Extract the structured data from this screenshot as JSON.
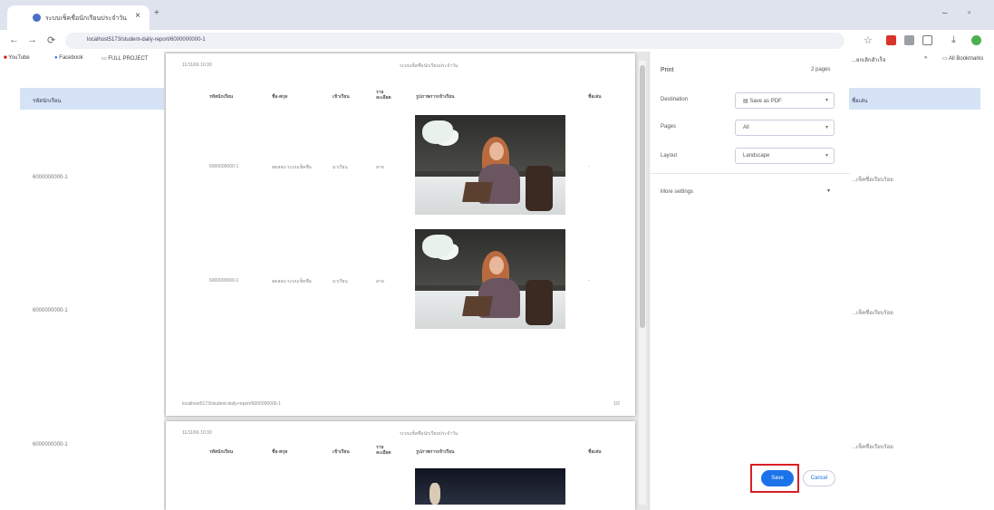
{
  "browser": {
    "tab_title": "ระบบเช็คชื่อนักเรียนประจำวัน",
    "url": "localhost5173/student-daily-report/6000000000-1",
    "bookmarks": [
      "YouTube",
      "Facebook",
      "FULL PROJECT"
    ],
    "bookmark_right": "All Bookmarks",
    "bookmark_partial": "...ยกเลิกสำเร็จ"
  },
  "background": {
    "header_left": "รหัสนักเรียน",
    "header_right": "ชื่อเล่น",
    "rows": [
      {
        "id": "6000000000-1",
        "right": "...เช็คชื่อเรียบร้อย"
      },
      {
        "id": "6000000000-1",
        "right": "...เช็คชื่อเรียบร้อย"
      },
      {
        "id": "6000000000-1",
        "right": "...เช็คชื่อเรียบร้อย"
      }
    ]
  },
  "preview": {
    "page1": {
      "header_left": "11/11/66 10:30",
      "header_center": "ระบบเช็คชื่อนักเรียนประจำวัน",
      "columns": [
        "รหัสนักเรียน",
        "ชื่อ-สกุล",
        "เข้าเรียน",
        "ราย ละเอียด",
        "รูปภาพการเข้าเรียน",
        "ชื่อเล่น"
      ],
      "rows": [
        [
          "6000000000-1",
          "ทดสอบ ระบบเช็คชื่อ",
          "มาเรียน",
          "สาย"
        ],
        [
          "6000000000-1",
          "ทดสอบ ระบบเช็คชื่อ",
          "มาเรียน",
          "สาย"
        ]
      ],
      "footer_left": "localhost5173/student-daily-report/6000000000-1",
      "footer_right": "1/2"
    },
    "page2": {
      "header_left": "11/11/66 10:30",
      "header_center": "ระบบเช็คชื่อนักเรียนประจำวัน",
      "columns": [
        "รหัสนักเรียน",
        "ชื่อ-สกุล",
        "เข้าเรียน",
        "ราย ละเอียด",
        "รูปภาพการเข้าเรียน",
        "ชื่อเล่น"
      ]
    }
  },
  "print_panel": {
    "title": "Print",
    "page_count": "2 pages",
    "destination_label": "Destination",
    "destination_value": "Save as PDF",
    "pages_label": "Pages",
    "pages_value": "All",
    "layout_label": "Layout",
    "layout_value": "Landscape",
    "more_settings": "More settings",
    "save_label": "Save",
    "cancel_label": "Cancel"
  },
  "colors": {
    "primary_button": "#1a73e8",
    "highlight": "#d81f26"
  }
}
